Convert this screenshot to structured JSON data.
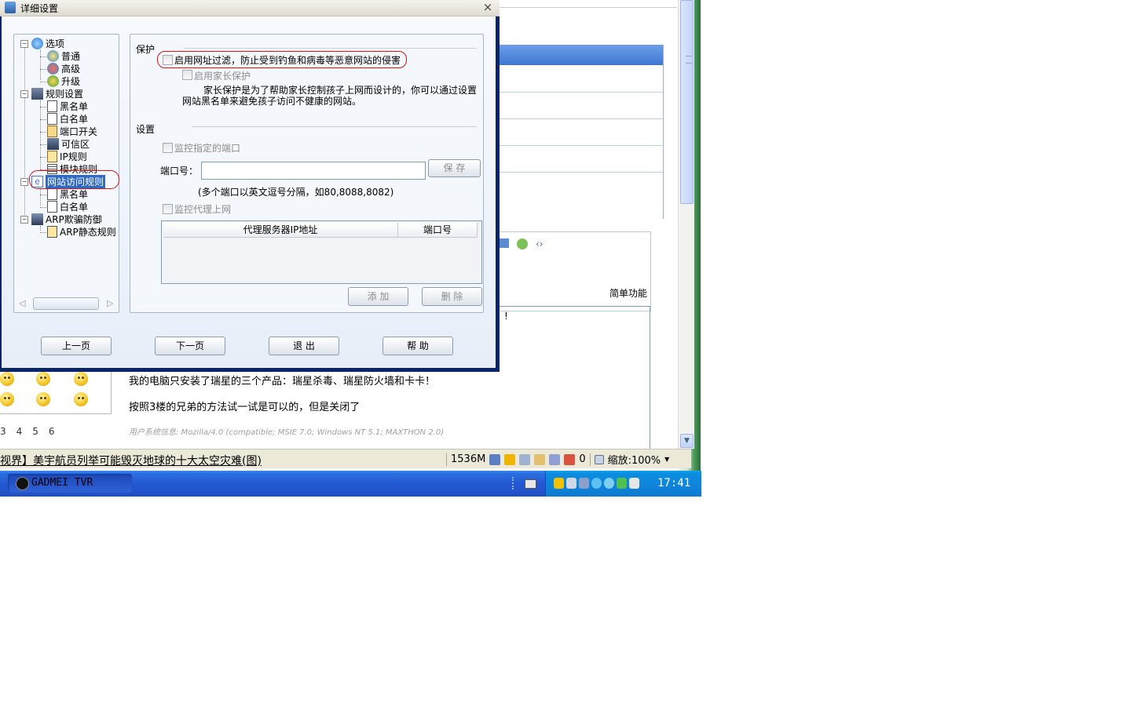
{
  "dialog": {
    "title": "详细设置",
    "close_label": "×",
    "tree": {
      "items": [
        {
          "label": "选项",
          "icon": "gear-globe-icon"
        },
        {
          "label": "普通",
          "icon": "gear-icon"
        },
        {
          "label": "高级",
          "icon": "gear-red-icon"
        },
        {
          "label": "升级",
          "icon": "upgrade-icon"
        },
        {
          "label": "规则设置",
          "icon": "rules-icon"
        },
        {
          "label": "黑名单",
          "icon": "document-icon"
        },
        {
          "label": "白名单",
          "icon": "document-icon"
        },
        {
          "label": "端口开关",
          "icon": "port-icon"
        },
        {
          "label": "可信区",
          "icon": "network-icon"
        },
        {
          "label": "IP规则",
          "icon": "ip-icon"
        },
        {
          "label": "模块规则",
          "icon": "module-icon"
        },
        {
          "label": "网站访问规则",
          "icon": "ie-icon",
          "selected": true
        },
        {
          "label": "黑名单",
          "icon": "document-icon"
        },
        {
          "label": "白名单",
          "icon": "document-icon"
        },
        {
          "label": "ARP欺骗防御",
          "icon": "arp-icon"
        },
        {
          "label": "ARP静态规则",
          "icon": "arp-static-icon"
        }
      ]
    },
    "protect": {
      "title": "保护",
      "url_filter_label": "启用网址过滤，防止受到钓鱼和病毒等恶意网站的侵害",
      "parent_label": "启用家长保护",
      "parent_desc_1": "家长保护是为了帮助家长控制孩子上网而设计的，你可以通过设置",
      "parent_desc_2": "网站黑名单来避免孩子访问不健康的网站。"
    },
    "settings": {
      "title": "设置",
      "monitor_port_label": "监控指定的端口",
      "port_label": "端口号：",
      "port_value": "",
      "save_label": "保 存",
      "port_hint": "(多个端口以英文逗号分隔，如80,8088,8082)",
      "monitor_proxy_label": "监控代理上网",
      "proxy_columns": [
        "代理服务器IP地址",
        "端口号"
      ],
      "add_label": "添 加",
      "delete_label": "删 除"
    },
    "footer": {
      "prev_label": "上一页",
      "next_label": "下一页",
      "exit_label": "退 出",
      "help_label": "帮 助"
    }
  },
  "browser": {
    "simple_function": "简单功能",
    "partial_line": "!",
    "post_lines": [
      "我的电脑只安装了瑞星的三个产品：瑞星杀毒、瑞星防火墙和卡卡！",
      "按照3楼的兄弟的方法试一试是可以的，但是关闭了"
    ],
    "user_agent": "用户系统信息:   Mozilla/4.0 (compatible; MSIE 7.0; Windows NT 5.1; MAXTHON 2.0)",
    "page_numbers": [
      "3",
      "4",
      "5",
      "6"
    ],
    "toolbar_glyph": "‹›"
  },
  "statusbar": {
    "news_text": "视界】美宇航员列举可能毁灭地球的十大太空灾难(图)",
    "memory": "1536M",
    "count": "0",
    "zoom": "缩放:100%"
  },
  "taskbar": {
    "app_label": "GADMEI TVR",
    "clock": "17:41"
  }
}
